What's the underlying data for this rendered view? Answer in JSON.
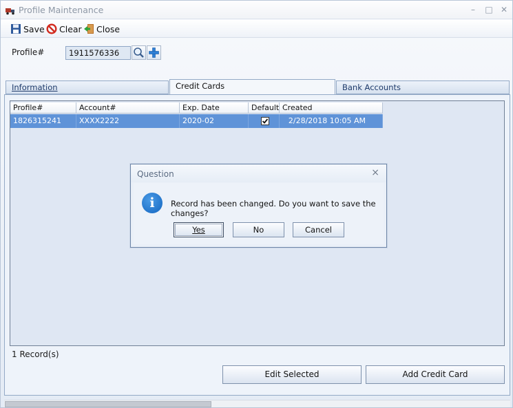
{
  "window": {
    "title": "Profile Maintenance"
  },
  "toolbar": {
    "save_label": "Save",
    "clear_label": "Clear",
    "close_label": "Close"
  },
  "profile": {
    "label": "Profile#",
    "value": "1911576336"
  },
  "tabs": [
    {
      "label": "Information"
    },
    {
      "label": "Credit Cards"
    },
    {
      "label": "Bank Accounts"
    }
  ],
  "grid": {
    "headers": [
      "Profile#",
      "Account#",
      "Exp. Date",
      "Default",
      "Created"
    ],
    "rows": [
      {
        "profile": "1826315241",
        "account": "XXXX2222",
        "exp": "2020-02",
        "default": true,
        "created": "2/28/2018 10:05 AM"
      }
    ]
  },
  "dialog": {
    "title": "Question",
    "message": "Record has been changed. Do you want to save the changes?",
    "yes_label": "Yes",
    "no_label": "No",
    "cancel_label": "Cancel"
  },
  "status": {
    "records": "1 Record(s)"
  },
  "buttons": {
    "edit_selected": "Edit Selected",
    "add_credit_card": "Add Credit Card"
  },
  "colors": {
    "selection": "#5f93d8",
    "accent": "#1265c0"
  }
}
